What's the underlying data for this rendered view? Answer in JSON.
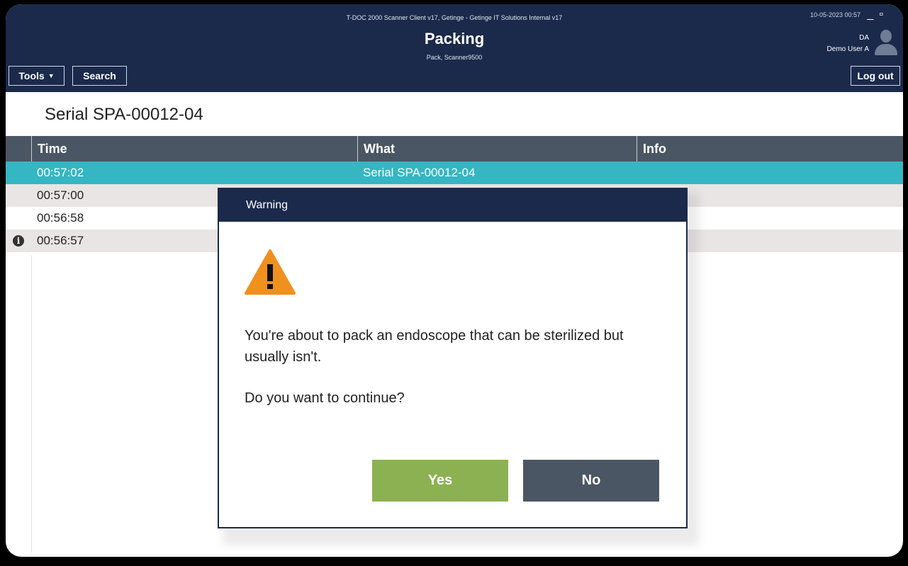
{
  "header": {
    "window_title": "T-DOC 2000 Scanner Client v17, Getinge - Getinge IT Solutions Internal v17",
    "page_title": "Packing",
    "page_subtitle": "Pack, Scanner9500",
    "clock": "10-05-2023 00:57",
    "user_initials": "DA",
    "user_name": "Demo User A",
    "tools_label": "Tools",
    "search_label": "Search",
    "logout_label": "Log out"
  },
  "serial_heading": "Serial SPA-00012-04",
  "table": {
    "columns": [
      "Time",
      "What",
      "Info"
    ],
    "rows": [
      {
        "time": "00:57:02",
        "what": "Serial SPA-00012-04",
        "info": ""
      },
      {
        "time": "00:57:00",
        "what": "",
        "info": ""
      },
      {
        "time": "00:56:58",
        "what": "",
        "info": ""
      },
      {
        "time": "00:56:57",
        "what": "",
        "info": ""
      }
    ]
  },
  "dialog": {
    "title": "Warning",
    "message": "You're about to pack an endoscope that can be sterilized but usually isn't.",
    "question": "Do you want to continue?",
    "yes_label": "Yes",
    "no_label": "No"
  },
  "colors": {
    "header_bg": "#1b2a4b",
    "selected_row": "#35b6c2",
    "yes_button": "#8cb152",
    "no_button": "#4a5663",
    "warning_icon": "#f0901e"
  }
}
